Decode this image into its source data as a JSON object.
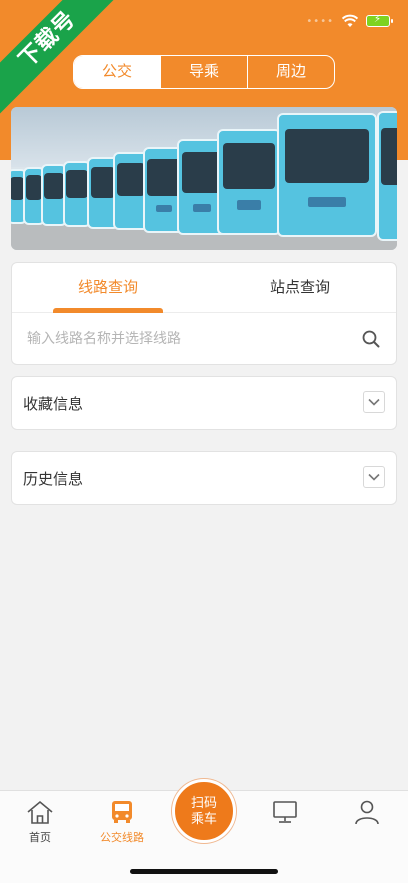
{
  "watermark": "下载号",
  "segment": {
    "items": [
      "公交",
      "导乘",
      "周边"
    ],
    "active": 0
  },
  "query_tabs": {
    "items": [
      "线路查询",
      "站点查询"
    ],
    "active": 0
  },
  "search": {
    "placeholder": "输入线路名称并选择线路"
  },
  "favorites": {
    "title": "收藏信息"
  },
  "history": {
    "title": "历史信息"
  },
  "tabbar": {
    "home": "首页",
    "bus_routes": "公交线路",
    "scan_line1": "扫码",
    "scan_line2": "乘车"
  },
  "colors": {
    "accent": "#f28a2b",
    "ribbon": "#1aa34a"
  },
  "icons": [
    "wifi-icon",
    "battery-icon",
    "search-icon",
    "chevron-down-icon",
    "home-icon",
    "bus-icon",
    "monitor-icon",
    "person-icon"
  ]
}
